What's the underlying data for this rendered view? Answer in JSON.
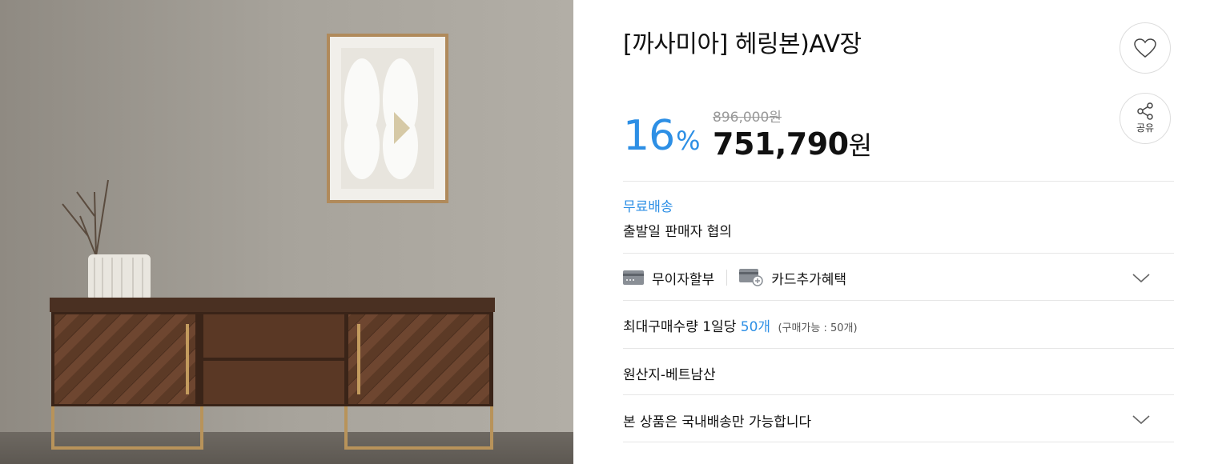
{
  "product": {
    "title": "[까사미아] 헤링본)AV장",
    "discount_value": "16",
    "discount_unit": "%",
    "original_price": "896,000원",
    "sale_price": "751,790",
    "sale_currency": "원"
  },
  "actions": {
    "share_label": "공유"
  },
  "shipping": {
    "fee": "무료배송",
    "dispatch": "출발일 판매자 협의"
  },
  "payment": {
    "installment_label": "무이자할부",
    "card_benefit_label": "카드추가혜택"
  },
  "purchase_limit": {
    "label": "최대구매수량 1일당",
    "max_qty": "50개",
    "available": "(구매가능 : 50개)"
  },
  "origin": "원산지-베트남산",
  "delivery_notice": "본 상품은 국내배송만 가능합니다",
  "colors": {
    "accent": "#2d8fe5",
    "text": "#111111",
    "muted": "#999999",
    "border": "#e6e6e6"
  },
  "icons": [
    "heart-icon",
    "share-icon",
    "credit-card-icon",
    "card-plus-icon",
    "chevron-down-icon"
  ]
}
